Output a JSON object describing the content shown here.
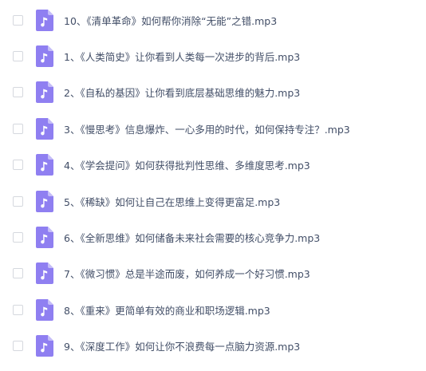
{
  "files": [
    {
      "name": "10、《清单革命》如何帮你消除“无能”之错.mp3",
      "icon": "audio-file-icon"
    },
    {
      "name": "1、《人类简史》让你看到人类每一次进步的背后.mp3",
      "icon": "audio-file-icon"
    },
    {
      "name": "2、《自私的基因》让你看到底层基础思维的魅力.mp3",
      "icon": "audio-file-icon"
    },
    {
      "name": "3、《慢思考》信息爆炸、一心多用的时代，如何保持专注？.mp3",
      "icon": "audio-file-icon"
    },
    {
      "name": "4、《学会提问》如何获得批判性思维、多维度思考.mp3",
      "icon": "audio-file-icon"
    },
    {
      "name": "5、《稀缺》如何让自己在思维上变得更富足.mp3",
      "icon": "audio-file-icon"
    },
    {
      "name": "6、《全新思维》如何储备未来社会需要的核心竞争力.mp3",
      "icon": "audio-file-icon"
    },
    {
      "name": "7、《微习惯》总是半途而废，如何养成一个好习惯.mp3",
      "icon": "audio-file-icon"
    },
    {
      "name": "8、《重来》更简单有效的商业和职场逻辑.mp3",
      "icon": "audio-file-icon"
    },
    {
      "name": "9、《深度工作》如何让你不浪费每一点脑力资源.mp3",
      "icon": "audio-file-icon"
    }
  ],
  "colors": {
    "icon_fill": "#8f7ff1",
    "icon_fold": "#c5bdf8",
    "text": "#424e67",
    "checkbox_border": "#d5d8de"
  }
}
